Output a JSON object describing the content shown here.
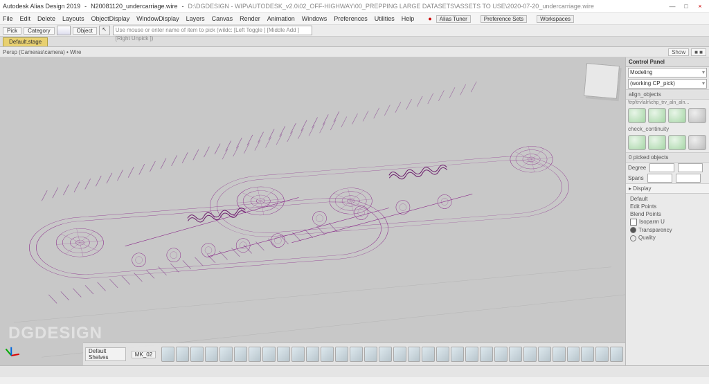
{
  "title": {
    "app": "Autodesk Alias Design 2019",
    "doc": "N20081120_undercarriage.wire",
    "path": "D:\\DGDESIGN - WIP\\AUTODESK_v2.0\\02_OFF-HIGHWAY\\00_PREPPING LARGE DATASETS\\ASSETS TO USE\\2020-07-20_undercarriage.wire"
  },
  "winbtns": {
    "min": "—",
    "max": "□",
    "close": "×"
  },
  "menu": {
    "items": [
      "File",
      "Edit",
      "Delete",
      "Layouts",
      "ObjectDisplay",
      "WindowDisplay",
      "Layers",
      "Canvas",
      "Render",
      "Animation",
      "Windows",
      "Preferences",
      "Utilities",
      "Help"
    ],
    "right": [
      "Preference Sets",
      "Workspaces"
    ]
  },
  "toolbar": {
    "pick": "Pick",
    "category": "Category",
    "picktool": "Object",
    "hint": "Use mouse or enter name of item to pick (wildc: [Left Toggle ] [Middle Add ] [Right Unpick ])"
  },
  "tab": {
    "active": "Default.stage"
  },
  "status": {
    "left": "Persp (Cameras\\camera) • Wire",
    "show": "Show",
    "toggle": "■ ■"
  },
  "watermark": "DGDESIGN",
  "shelf": {
    "tabs": [
      "Default Shelves",
      "MK_02"
    ]
  },
  "panel": {
    "title": "Control Panel",
    "mode": "Modeling",
    "section1": "(working CP_pick)",
    "section2": "align_objects",
    "filelabel": "\\trp\\trv\\aln\\chp_trv_aln_aln...",
    "check": "check_continuity",
    "picked_header": "0 picked objects",
    "degree": "Degree",
    "spans": "Spans",
    "display": "Display",
    "disp_items": [
      "Default",
      "Edit Points",
      "Blend Points",
      "Isoparm U"
    ],
    "radios": [
      "Transparency",
      "Quality"
    ]
  },
  "colors": {
    "wire": "#8a2b8a",
    "wire2": "#a060a0",
    "bg": "#c8c8c8"
  }
}
